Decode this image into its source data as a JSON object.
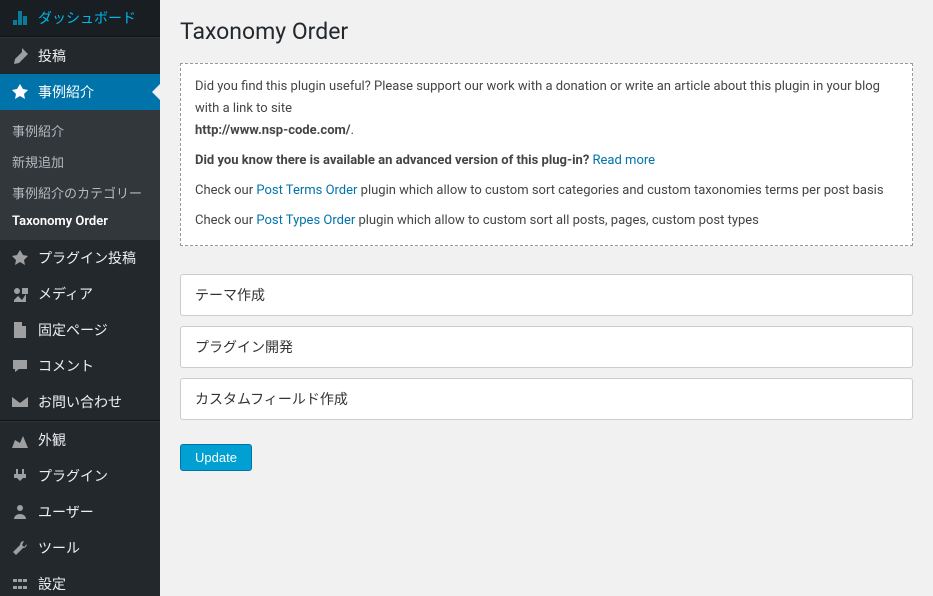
{
  "sidebar": {
    "items": [
      {
        "label": "ダッシュボード",
        "icon": "dashboard"
      },
      {
        "label": "投稿",
        "icon": "post"
      },
      {
        "label": "事例紹介",
        "icon": "pin",
        "active": true
      },
      {
        "label": "プラグイン投稿",
        "icon": "pin"
      },
      {
        "label": "メディア",
        "icon": "media"
      },
      {
        "label": "固定ページ",
        "icon": "page"
      },
      {
        "label": "コメント",
        "icon": "comment"
      },
      {
        "label": "お問い合わせ",
        "icon": "mail"
      },
      {
        "label": "外観",
        "icon": "appearance"
      },
      {
        "label": "プラグイン",
        "icon": "plugins"
      },
      {
        "label": "ユーザー",
        "icon": "users"
      },
      {
        "label": "ツール",
        "icon": "tools"
      },
      {
        "label": "設定",
        "icon": "settings"
      }
    ],
    "submenu": [
      {
        "label": "事例紹介"
      },
      {
        "label": "新規追加"
      },
      {
        "label": "事例紹介のカテゴリー"
      },
      {
        "label": "Taxonomy Order",
        "current": true
      }
    ]
  },
  "page": {
    "title": "Taxonomy Order"
  },
  "infobox": {
    "intro": "Did you find this plugin useful? Please support our work with a donation or write an article about this plugin in your blog with a link to site",
    "url": "http://www.nsp-code.com/",
    "advanced_q": "Did you know there is available an advanced version of this plug-in? ",
    "readmore": "Read more",
    "check1_pre": "Check our ",
    "check1_link": "Post Terms Order",
    "check1_post": " plugin which allow to custom sort categories and custom taxonomies terms per post basis",
    "check2_pre": "Check our ",
    "check2_link": "Post Types Order",
    "check2_post": " plugin which allow to custom sort all posts, pages, custom post types"
  },
  "sortable": [
    {
      "label": "テーマ作成"
    },
    {
      "label": "プラグイン開発"
    },
    {
      "label": "カスタムフィールド作成"
    }
  ],
  "buttons": {
    "update": "Update"
  }
}
